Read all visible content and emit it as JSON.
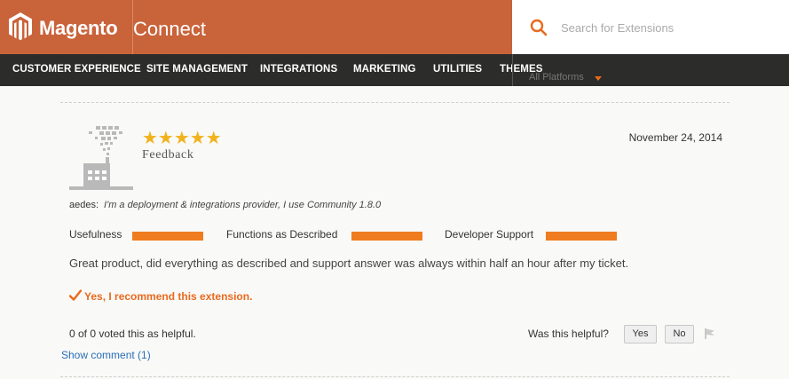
{
  "header": {
    "logo_text": "Magento",
    "brand_text": "Connect",
    "search_placeholder": "Search for Extensions",
    "brand_color": "#c9633a"
  },
  "nav": {
    "items": [
      "CUSTOMER EXPERIENCE",
      "SITE MANAGEMENT",
      "INTEGRATIONS",
      "MARKETING",
      "UTILITIES",
      "THEMES"
    ],
    "platform_label": "All Platforms"
  },
  "review": {
    "stars": "★★★★★",
    "title": "Feedback",
    "date": "November 24, 2014",
    "username": "aedes:",
    "user_description": "I'm a deployment & integrations provider, I use  Community  1.8.0",
    "ratings": [
      {
        "label": "Usefulness",
        "value": 1.0
      },
      {
        "label": "Functions as Described",
        "value": 1.0
      },
      {
        "label": "Developer Support",
        "value": 1.0
      }
    ],
    "text": "Great product, did everything as described and support answer was always within half an hour after my ticket.",
    "recommend": "Yes, I recommend this extension.",
    "voted": "0 of 0 voted this as helpful.",
    "helpful_question": "Was this helpful?",
    "yes_label": "Yes",
    "no_label": "No",
    "show_comment": "Show comment (1)",
    "accent_color": "#ef7c1f",
    "star_color": "#f1b21c"
  }
}
